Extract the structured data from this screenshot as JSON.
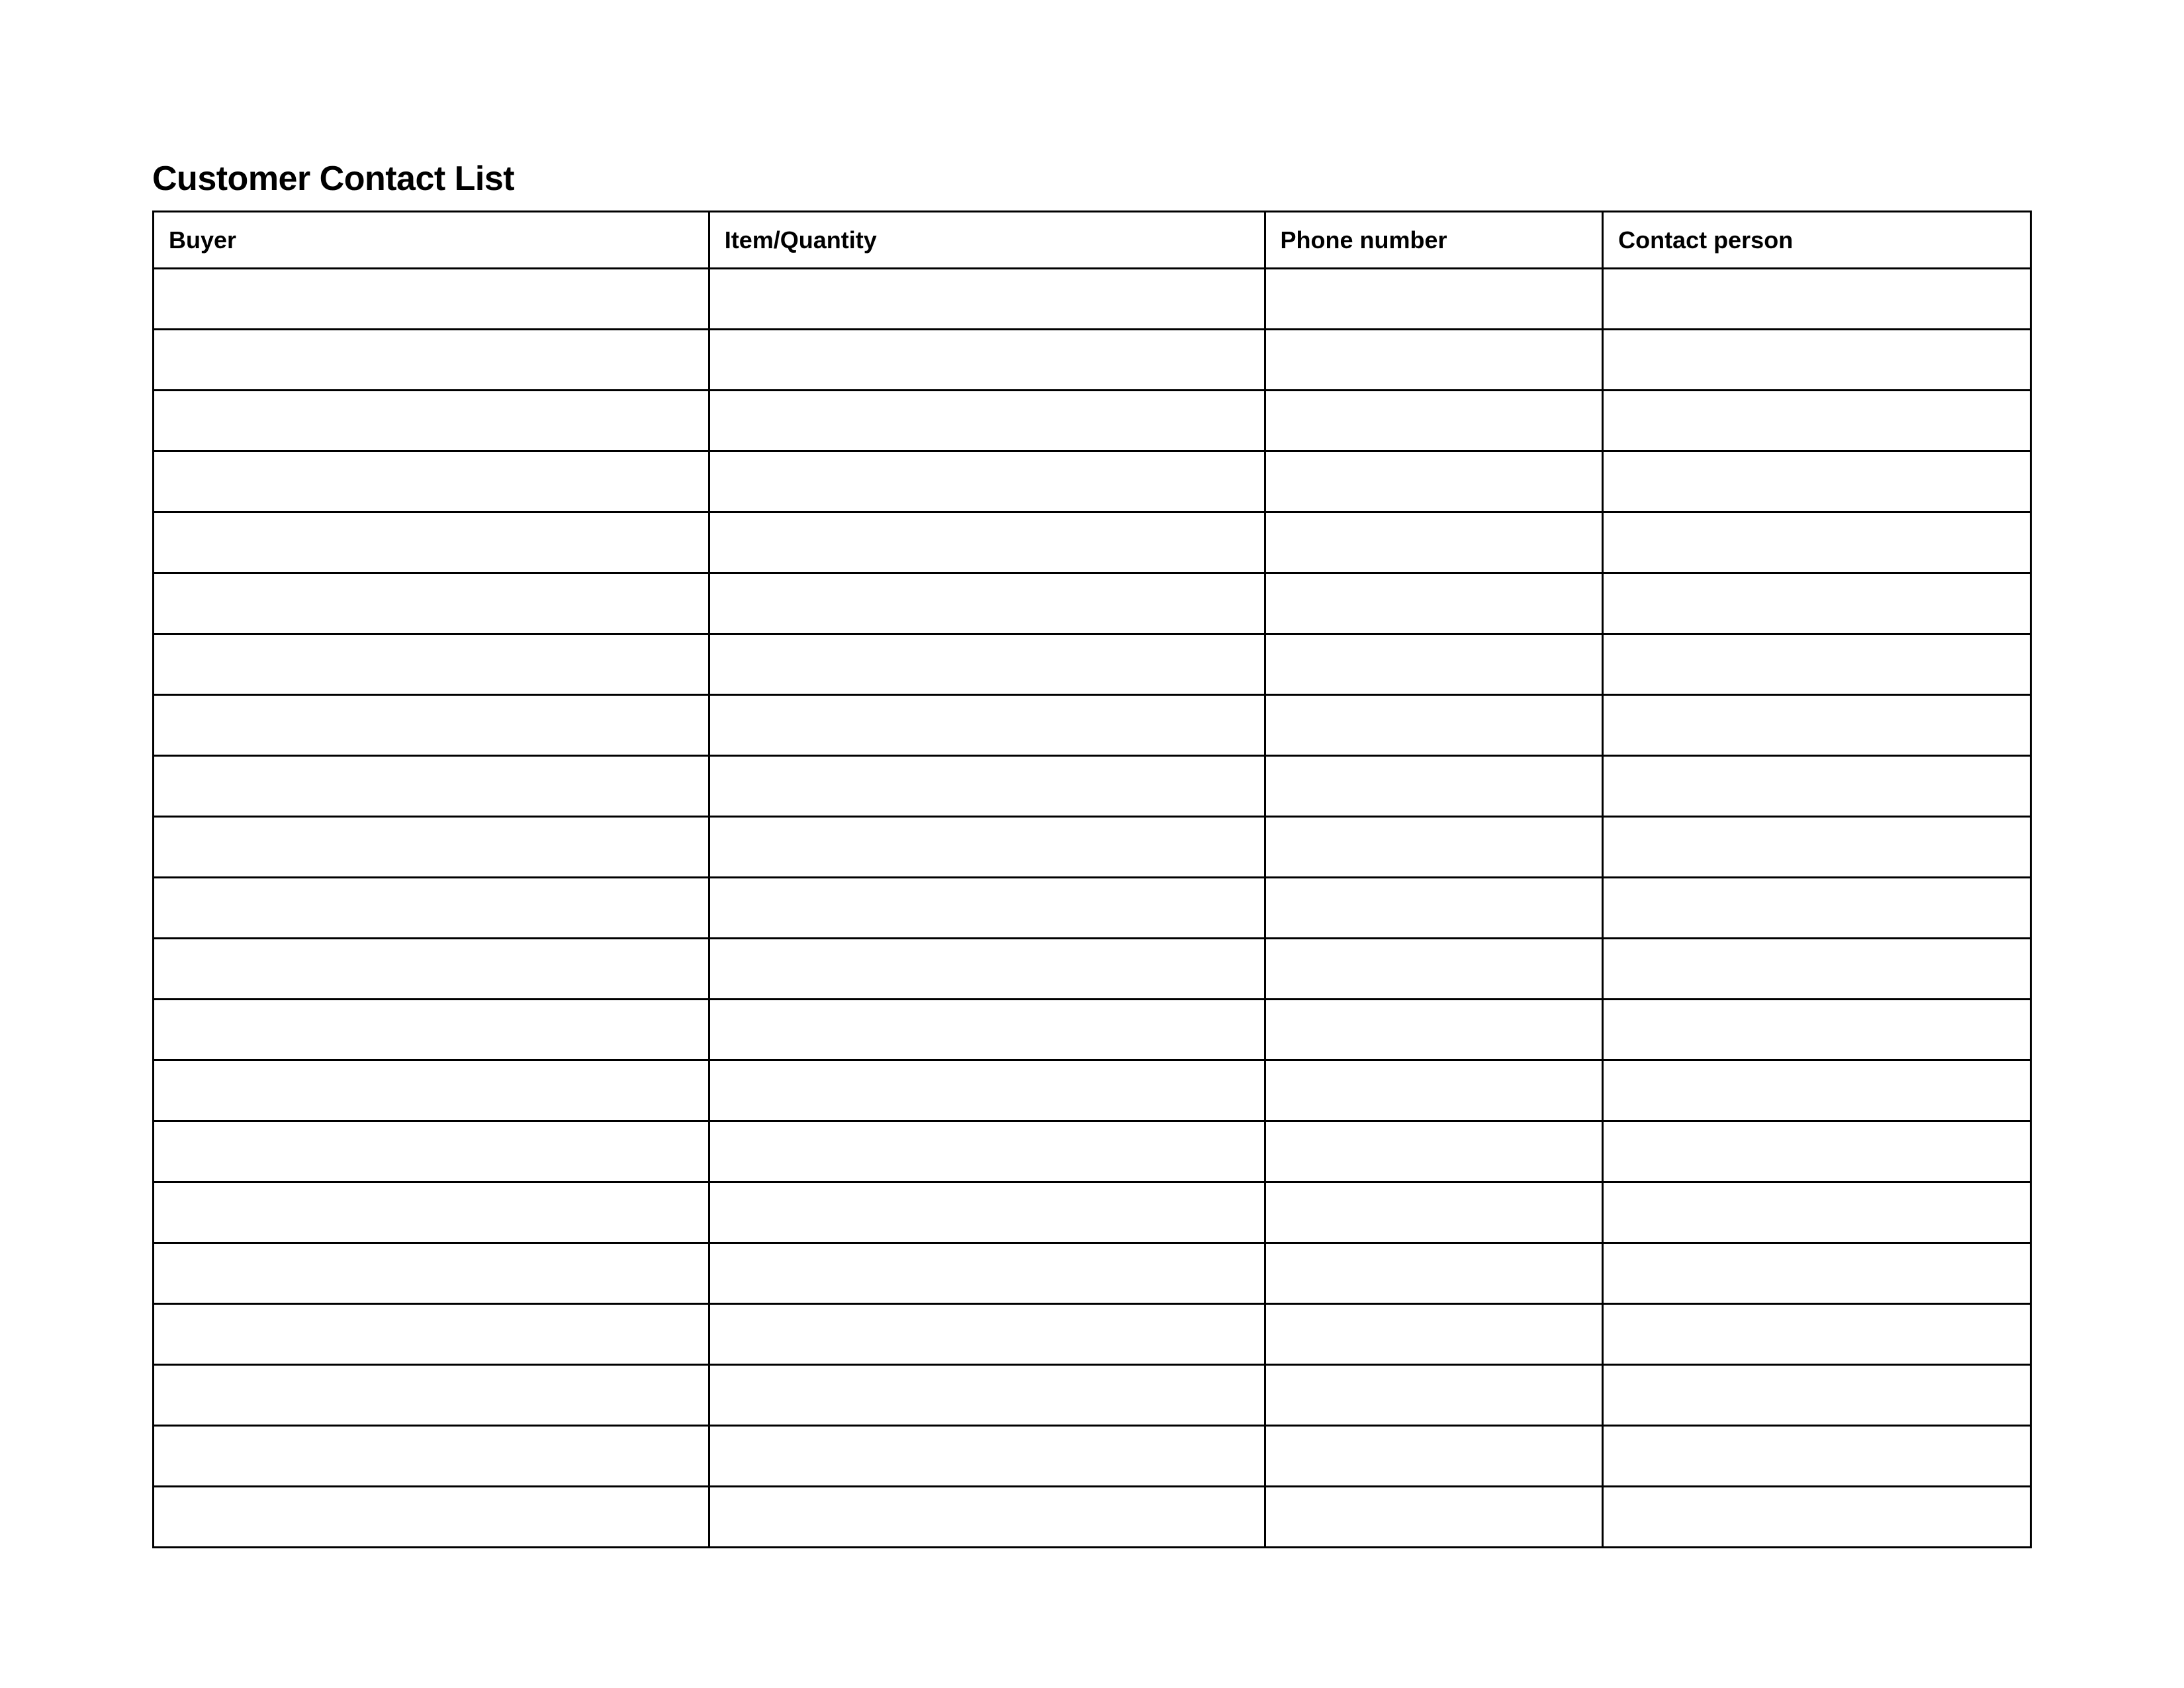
{
  "title": "Customer Contact List",
  "table": {
    "headers": {
      "buyer": "Buyer",
      "item_quantity": "Item/Quantity",
      "phone_number": "Phone number",
      "contact_person": "Contact person"
    },
    "rows": [
      {
        "buyer": "",
        "item_quantity": "",
        "phone_number": "",
        "contact_person": ""
      },
      {
        "buyer": "",
        "item_quantity": "",
        "phone_number": "",
        "contact_person": ""
      },
      {
        "buyer": "",
        "item_quantity": "",
        "phone_number": "",
        "contact_person": ""
      },
      {
        "buyer": "",
        "item_quantity": "",
        "phone_number": "",
        "contact_person": ""
      },
      {
        "buyer": "",
        "item_quantity": "",
        "phone_number": "",
        "contact_person": ""
      },
      {
        "buyer": "",
        "item_quantity": "",
        "phone_number": "",
        "contact_person": ""
      },
      {
        "buyer": "",
        "item_quantity": "",
        "phone_number": "",
        "contact_person": ""
      },
      {
        "buyer": "",
        "item_quantity": "",
        "phone_number": "",
        "contact_person": ""
      },
      {
        "buyer": "",
        "item_quantity": "",
        "phone_number": "",
        "contact_person": ""
      },
      {
        "buyer": "",
        "item_quantity": "",
        "phone_number": "",
        "contact_person": ""
      },
      {
        "buyer": "",
        "item_quantity": "",
        "phone_number": "",
        "contact_person": ""
      },
      {
        "buyer": "",
        "item_quantity": "",
        "phone_number": "",
        "contact_person": ""
      },
      {
        "buyer": "",
        "item_quantity": "",
        "phone_number": "",
        "contact_person": ""
      },
      {
        "buyer": "",
        "item_quantity": "",
        "phone_number": "",
        "contact_person": ""
      },
      {
        "buyer": "",
        "item_quantity": "",
        "phone_number": "",
        "contact_person": ""
      },
      {
        "buyer": "",
        "item_quantity": "",
        "phone_number": "",
        "contact_person": ""
      },
      {
        "buyer": "",
        "item_quantity": "",
        "phone_number": "",
        "contact_person": ""
      },
      {
        "buyer": "",
        "item_quantity": "",
        "phone_number": "",
        "contact_person": ""
      },
      {
        "buyer": "",
        "item_quantity": "",
        "phone_number": "",
        "contact_person": ""
      },
      {
        "buyer": "",
        "item_quantity": "",
        "phone_number": "",
        "contact_person": ""
      },
      {
        "buyer": "",
        "item_quantity": "",
        "phone_number": "",
        "contact_person": ""
      }
    ]
  }
}
